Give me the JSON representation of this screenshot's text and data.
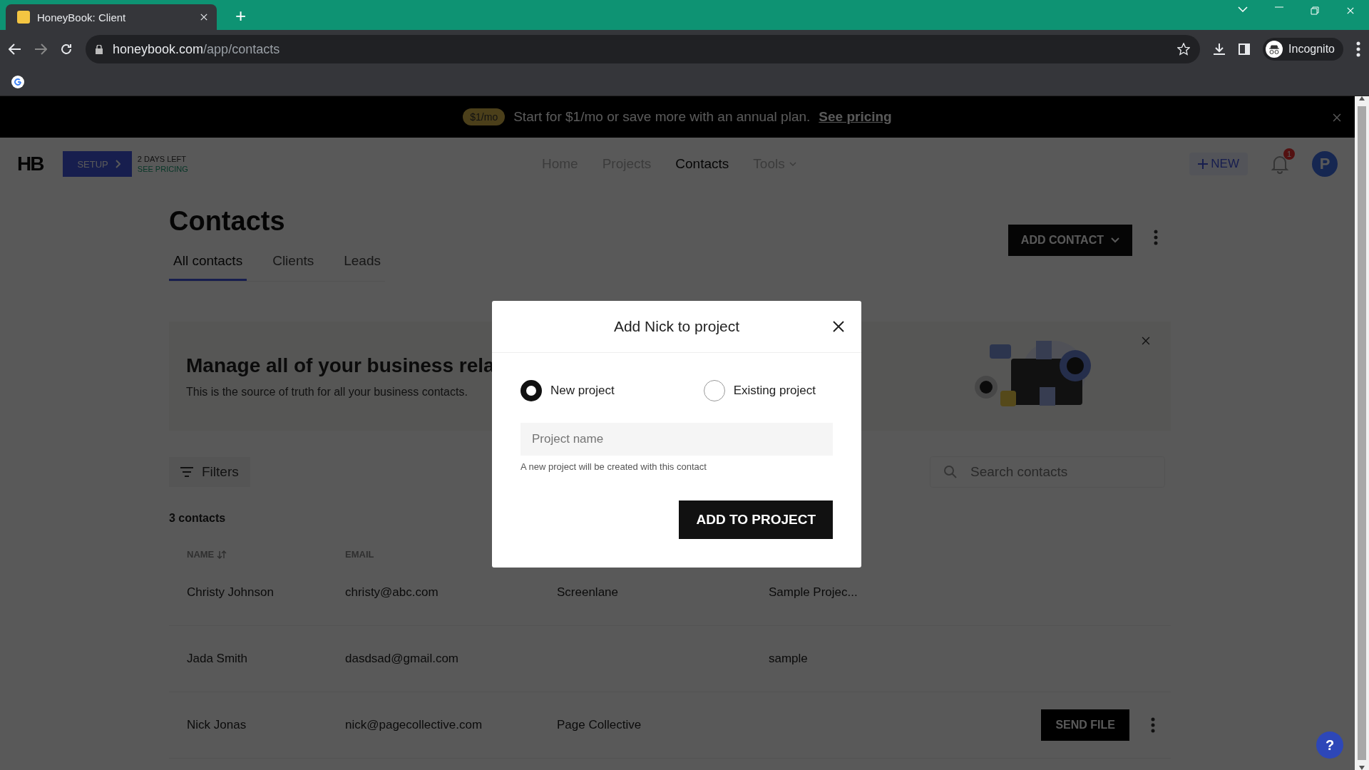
{
  "browser": {
    "tab_title": "HoneyBook: Client",
    "new_tab": "+",
    "url_domain": "honeybook.com",
    "url_path": "/app/contacts",
    "profile_label": "Incognito"
  },
  "promo": {
    "pill": "$1/mo",
    "text": "Start for $1/mo or save more with an annual plan.",
    "link": "See pricing"
  },
  "header": {
    "logo": "HB",
    "setup_button": "SETUP",
    "trial_days": "2 DAYS LEFT",
    "trial_link": "SEE PRICING",
    "nav": [
      {
        "label": "Home",
        "selected": false,
        "caret": false
      },
      {
        "label": "Projects",
        "selected": false,
        "caret": false
      },
      {
        "label": "Contacts",
        "selected": true,
        "caret": false
      },
      {
        "label": "Tools",
        "selected": false,
        "caret": true
      }
    ],
    "new_button": "NEW",
    "notification_count": "1",
    "avatar_initial": "P"
  },
  "page": {
    "title": "Contacts",
    "add_contact_button": "ADD CONTACT",
    "tabs": [
      {
        "label": "All contacts",
        "selected": true
      },
      {
        "label": "Clients",
        "selected": false
      },
      {
        "label": "Leads",
        "selected": false
      }
    ]
  },
  "info_card": {
    "title": "Manage all of your business rela",
    "subtitle": "This is the source of truth for all your business contacts."
  },
  "filters_label": "Filters",
  "search_placeholder": "Search contacts",
  "count_label": "3 contacts",
  "table": {
    "columns": [
      "NAME",
      "EMAIL"
    ],
    "rows": [
      {
        "cells": [
          "Christy Johnson",
          "christy@abc.com",
          "Screenlane",
          "Sample Projec..."
        ]
      },
      {
        "cells": [
          "Jada Smith",
          "dasdsad@gmail.com",
          "",
          "sample"
        ]
      },
      {
        "cells": [
          "Nick Jonas",
          "nick@pagecollective.com",
          "Page Collective",
          ""
        ],
        "action": "SEND FILE"
      }
    ]
  },
  "modal": {
    "title": "Add Nick to project",
    "options": [
      {
        "label": "New project",
        "selected": true
      },
      {
        "label": "Existing project",
        "selected": false
      }
    ],
    "field_placeholder": "Project name",
    "hint": "A new project will be created with this contact",
    "submit": "ADD TO PROJECT"
  },
  "help_button": "?"
}
